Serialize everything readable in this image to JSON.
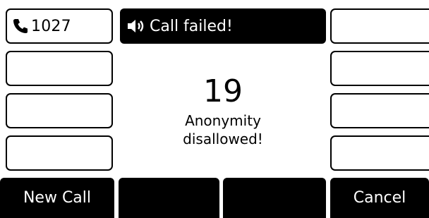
{
  "line_keys": {
    "left": [
      {
        "label": "1027",
        "icon": "phone-icon"
      },
      {
        "label": ""
      },
      {
        "label": ""
      },
      {
        "label": ""
      }
    ],
    "right": [
      {
        "label": ""
      },
      {
        "label": ""
      },
      {
        "label": ""
      },
      {
        "label": ""
      }
    ]
  },
  "titlebar": {
    "icon": "speaker-icon",
    "text": "Call failed!"
  },
  "status": {
    "code": "19",
    "message_line1": "Anonymity",
    "message_line2": "disallowed!"
  },
  "softkeys": [
    "New Call",
    "",
    "",
    "Cancel"
  ],
  "colors": {
    "background": "#ffffff",
    "bar": "#000000",
    "text_on_bar": "#ffffff"
  }
}
